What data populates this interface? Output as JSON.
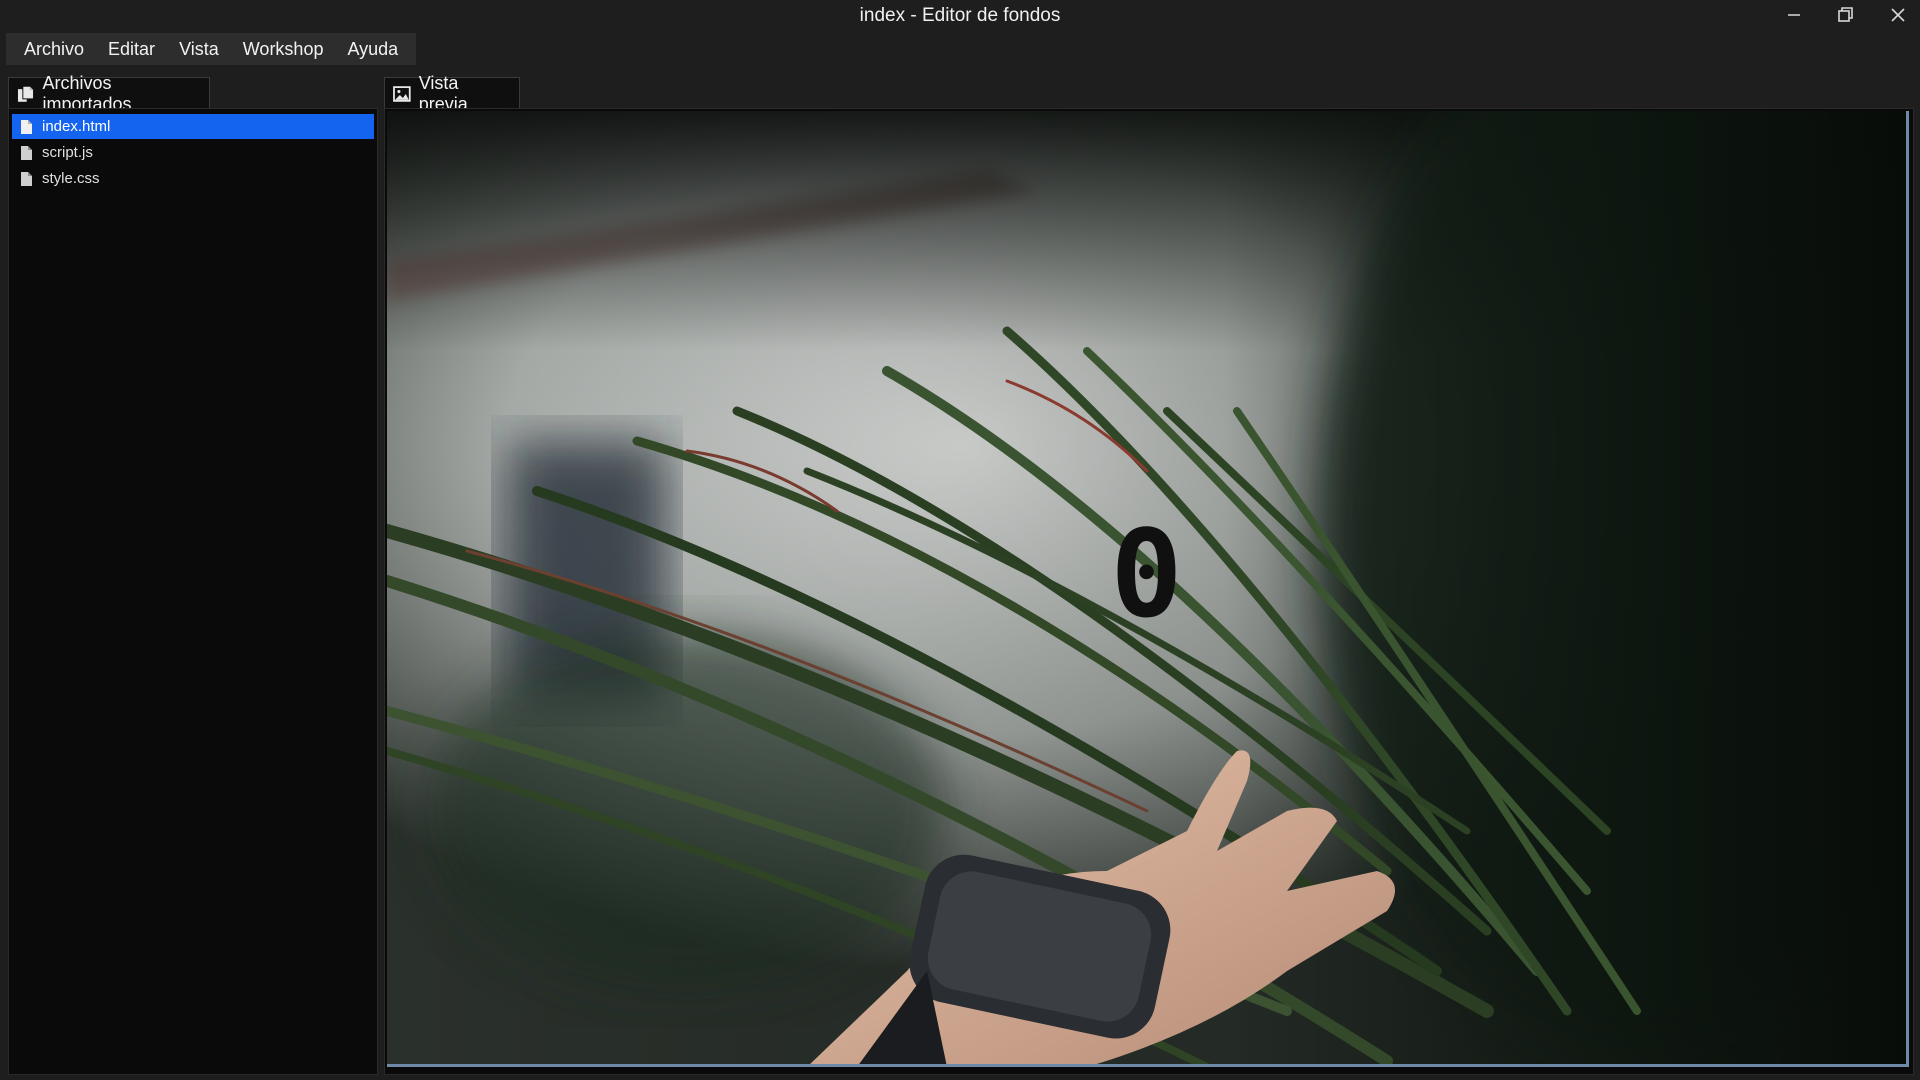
{
  "window": {
    "title": "index - Editor de fondos",
    "controls": [
      "minimize-icon",
      "restore-icon",
      "close-icon"
    ]
  },
  "menu": {
    "items": [
      "Archivo",
      "Editar",
      "Vista",
      "Workshop",
      "Ayuda"
    ]
  },
  "files_panel": {
    "tab_label": "Archivos importados",
    "icon": "files-icon",
    "files": [
      {
        "name": "index.html",
        "selected": true,
        "icon": "file-icon"
      },
      {
        "name": "script.js",
        "selected": false,
        "icon": "file-icon"
      },
      {
        "name": "style.css",
        "selected": false,
        "icon": "file-icon"
      }
    ]
  },
  "preview_panel": {
    "tab_label": "Vista previa",
    "icon": "image-icon",
    "counter_text": "0"
  },
  "colors": {
    "background": "#1e1e1e",
    "menubar": "#2d2d2d",
    "panel": "#0a0a0a",
    "selection": "#1464f0",
    "preview_border": "#6f8aa8"
  }
}
